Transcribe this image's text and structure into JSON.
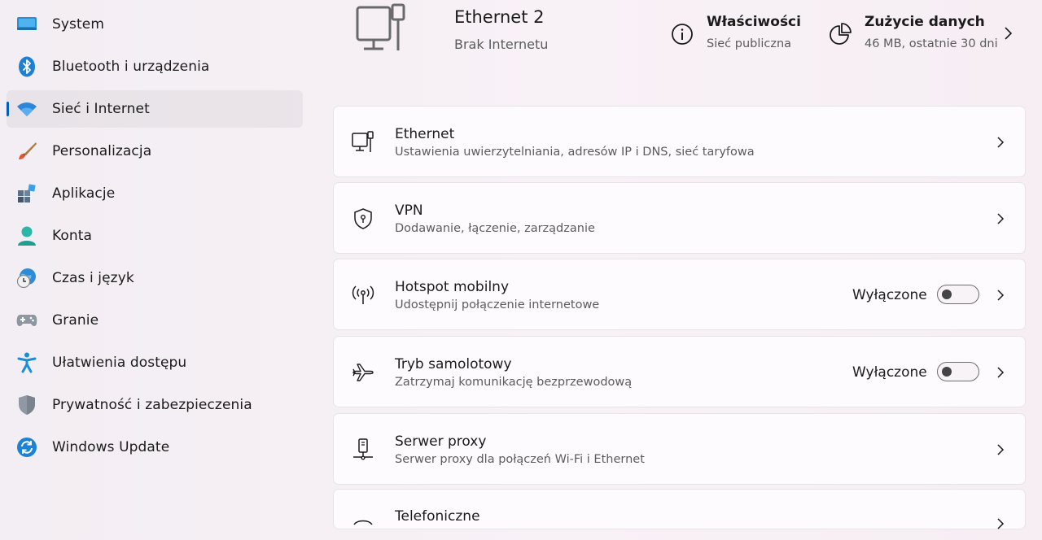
{
  "sidebar": {
    "items": [
      {
        "label": "System",
        "icon": "system-icon"
      },
      {
        "label": "Bluetooth i urządzenia",
        "icon": "bluetooth-icon"
      },
      {
        "label": "Sieć i Internet",
        "icon": "wifi-icon",
        "active": true
      },
      {
        "label": "Personalizacja",
        "icon": "brush-icon"
      },
      {
        "label": "Aplikacje",
        "icon": "apps-icon"
      },
      {
        "label": "Konta",
        "icon": "account-icon"
      },
      {
        "label": "Czas i język",
        "icon": "time-language-icon"
      },
      {
        "label": "Granie",
        "icon": "gamepad-icon"
      },
      {
        "label": "Ułatwienia dostępu",
        "icon": "accessibility-icon"
      },
      {
        "label": "Prywatność i zabezpieczenia",
        "icon": "shield-icon"
      },
      {
        "label": "Windows Update",
        "icon": "windows-update-icon"
      }
    ]
  },
  "header": {
    "device_icon": "ethernet-device-icon",
    "title": "Ethernet 2",
    "subtitle": "Brak Internetu",
    "properties": {
      "title": "Właściwości",
      "subtitle": "Sieć publiczna",
      "icon": "info-icon"
    },
    "data_usage": {
      "title": "Zużycie danych",
      "subtitle": "46 MB, ostatnie 30 dni",
      "icon": "pie-chart-icon"
    }
  },
  "cards": [
    {
      "title": "Ethernet",
      "subtitle": "Ustawienia uwierzytelniania, adresów IP i DNS, sieć taryfowa",
      "icon": "ethernet-icon"
    },
    {
      "title": "VPN",
      "subtitle": "Dodawanie, łączenie, zarządzanie",
      "icon": "vpn-shield-icon"
    },
    {
      "title": "Hotspot mobilny",
      "subtitle": "Udostępnij połączenie internetowe",
      "icon": "hotspot-icon",
      "state": "Wyłączone",
      "toggle_on": false
    },
    {
      "title": "Tryb samolotowy",
      "subtitle": "Zatrzymaj komunikację bezprzewodową",
      "icon": "airplane-icon",
      "state": "Wyłączone",
      "toggle_on": false
    },
    {
      "title": "Serwer proxy",
      "subtitle": "Serwer proxy dla połączeń Wi-Fi i Ethernet",
      "icon": "proxy-icon"
    },
    {
      "title": "Telefoniczne",
      "subtitle": "",
      "icon": "dialup-icon"
    }
  ],
  "colors": {
    "accent": "#005fb8",
    "card_bg": "#fdfbfd",
    "text_secondary": "#5c5c5c"
  }
}
